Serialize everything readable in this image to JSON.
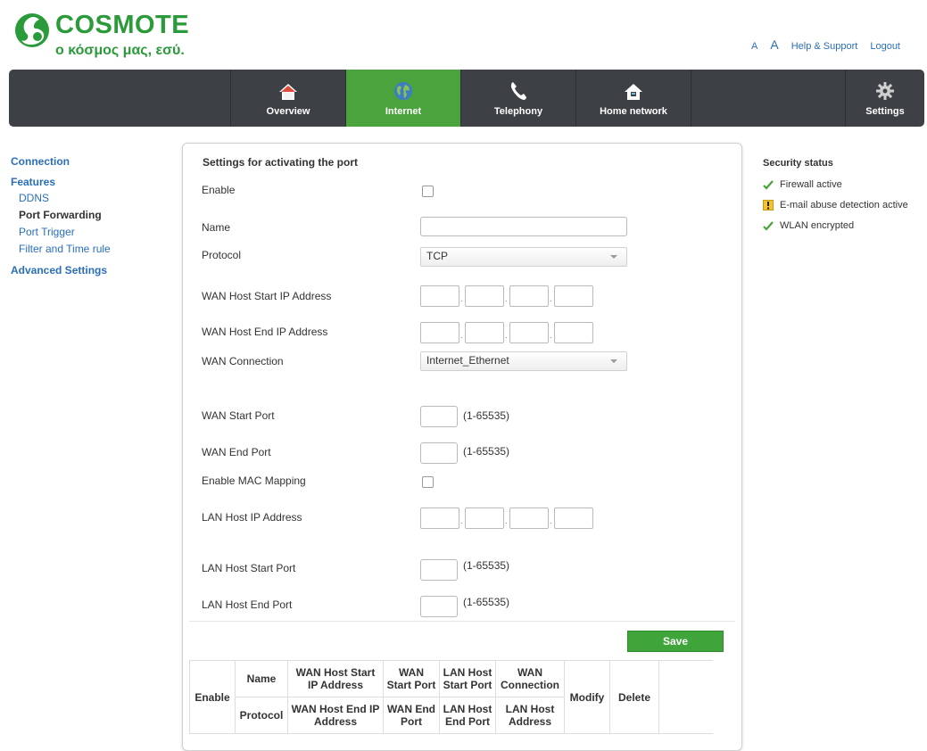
{
  "header": {
    "brand": "COSMOTE",
    "tagline": "ο κόσμος μας, εσύ.",
    "links": {
      "font_small": "A",
      "font_large": "A",
      "help": "Help & Support",
      "logout": "Logout"
    }
  },
  "nav": [
    {
      "label": "Overview",
      "icon": "home-icon"
    },
    {
      "label": "Internet",
      "icon": "globe-icon",
      "active": true
    },
    {
      "label": "Telephony",
      "icon": "phone-icon"
    },
    {
      "label": "Home network",
      "icon": "home-network-icon"
    },
    {
      "label": "Settings",
      "icon": "gear-icon"
    }
  ],
  "sidebar": {
    "connection": "Connection",
    "features": "Features",
    "items": [
      "DDNS",
      "Port Forwarding",
      "Port Trigger",
      "Filter and Time rule"
    ],
    "active_item": "Port Forwarding",
    "advanced": "Advanced Settings"
  },
  "form": {
    "title": "Settings for activating the port",
    "enable": "Enable",
    "name": "Name",
    "name_value": "",
    "protocol": "Protocol",
    "protocol_value": "TCP",
    "wan_host_start_ip": "WAN Host Start IP Address",
    "wan_host_end_ip": "WAN Host End IP Address",
    "wan_connection": "WAN Connection",
    "wan_connection_value": "Internet_Ethernet",
    "wan_start_port": "WAN Start Port",
    "wan_end_port": "WAN End Port",
    "enable_mac_mapping": "Enable MAC Mapping",
    "lan_host_ip": "LAN Host IP Address",
    "lan_host_start_port": "LAN Host Start Port",
    "lan_host_end_port": "LAN Host End Port",
    "port_range_hint": "(1-65535)",
    "save": "Save"
  },
  "table": {
    "enable": "Enable",
    "name": "Name",
    "protocol": "Protocol",
    "wan_host_start_ip": "WAN Host Start IP Address",
    "wan_host_end_ip": "WAN Host End IP Address",
    "wan_start_port": "WAN Start Port",
    "wan_end_port": "WAN End Port",
    "lan_host_start_port": "LAN Host Start Port",
    "lan_host_end_port": "LAN Host End Port",
    "wan_connection": "WAN Connection",
    "lan_host_address": "LAN Host Address",
    "modify": "Modify",
    "delete": "Delete"
  },
  "security": {
    "title": "Security status",
    "items": [
      {
        "label": "Firewall active",
        "status": "ok"
      },
      {
        "label": "E-mail abuse detection active",
        "status": "warning"
      },
      {
        "label": "WLAN encrypted",
        "status": "ok"
      }
    ]
  },
  "colors": {
    "brand_green": "#2a9a3a",
    "nav_bg": "#3d4146",
    "nav_active": "#4aa33c",
    "link_blue": "#2a6ebb"
  }
}
